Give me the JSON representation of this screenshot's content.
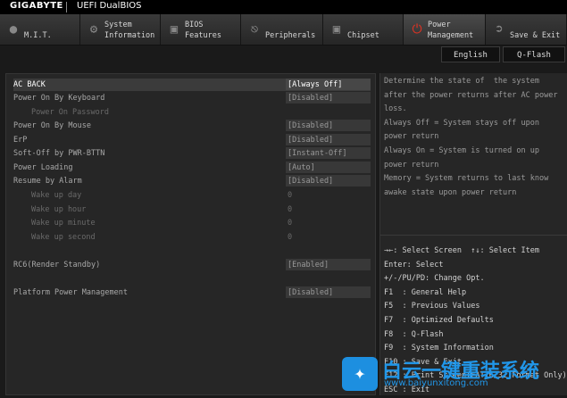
{
  "header": {
    "brand": "GIGABYTE",
    "product": "UEFI DualBIOS"
  },
  "tabs": [
    {
      "label": "M.I.T.",
      "icon": "disc-icon",
      "active": false
    },
    {
      "label": "System\nInformation",
      "icon": "gear-icon",
      "active": false
    },
    {
      "label": "BIOS\nFeatures",
      "icon": "chip-plus-icon",
      "active": false
    },
    {
      "label": "Peripherals",
      "icon": "plug-icon",
      "active": false
    },
    {
      "label": "Chipset",
      "icon": "chipset-icon",
      "active": false
    },
    {
      "label": "Power\nManagement",
      "icon": "power-icon",
      "active": true
    },
    {
      "label": "Save & Exit",
      "icon": "exit-icon",
      "active": false
    }
  ],
  "toolbar": {
    "language": "English",
    "qflash": "Q-Flash"
  },
  "settings": [
    {
      "name": "AC BACK",
      "value": "[Always Off]",
      "selected": true
    },
    {
      "name": "Power On By Keyboard",
      "value": "[Disabled]"
    },
    {
      "name": "Power On Password",
      "value": ""
    },
    {
      "name": "Power On By Mouse",
      "value": "[Disabled]"
    },
    {
      "name": "ErP",
      "value": "[Disabled]"
    },
    {
      "name": "Soft-Off by PWR-BTTN",
      "value": "[Instant-Off]"
    },
    {
      "name": "Power Loading",
      "value": "[Auto]"
    },
    {
      "name": "Resume by Alarm",
      "value": "[Disabled]"
    },
    {
      "name": "Wake up day",
      "value": "0"
    },
    {
      "name": "Wake up hour",
      "value": "0"
    },
    {
      "name": "Wake up minute",
      "value": "0"
    },
    {
      "name": "Wake up second",
      "value": "0"
    },
    {
      "name": "RC6(Render Standby)",
      "value": "[Enabled]"
    },
    {
      "name": "Platform Power Management",
      "value": "[Disabled]"
    }
  ],
  "help": [
    "Determine the state of  the system",
    "after the power returns after AC power",
    "loss.",
    "Always Off = System stays off upon",
    "power return",
    "Always On = System is turned on up",
    "power return",
    "Memory = System returns to last know",
    "awake state upon power return"
  ],
  "keys": [
    "→←: Select Screen  ↑↓: Select Item",
    "Enter: Select",
    "+/-/PU/PD: Change Opt.",
    "F1  : General Help",
    "F5  : Previous Values",
    "F7  : Optimized Defaults",
    "F8  : Q-Flash",
    "F9  : System Information",
    "F10 : Save & Exit",
    "F12 : Print Screen(FAT16/32 Format Only)",
    "ESC : Exit"
  ],
  "watermark": {
    "title": "白云一键重装系统",
    "url": "www.baiyunxitong.com"
  },
  "colors": {
    "accent": "#e63222",
    "watermark": "#2196e8"
  }
}
